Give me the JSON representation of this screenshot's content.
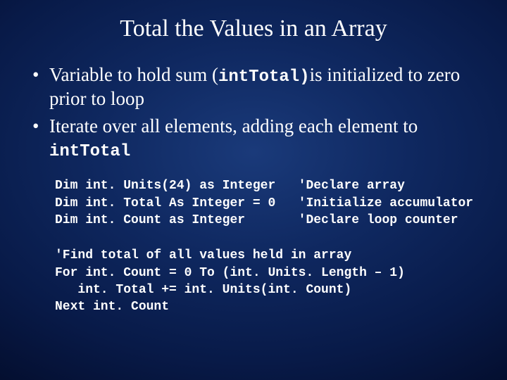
{
  "title": "Total the Values in an Array",
  "bullets": [
    {
      "pre": "Variable to hold sum (",
      "code": "intTotal)",
      "post": "is initialized to zero prior to loop"
    },
    {
      "pre": "Iterate over all elements, adding each element to ",
      "code": "intTotal",
      "post": ""
    }
  ],
  "code1": "Dim int. Units(24) as Integer   'Declare array\nDim int. Total As Integer = 0   'Initialize accumulator\nDim int. Count as Integer       'Declare loop counter",
  "code2": "'Find total of all values held in array\nFor int. Count = 0 To (int. Units. Length – 1)\n   int. Total += int. Units(int. Count)\nNext int. Count"
}
